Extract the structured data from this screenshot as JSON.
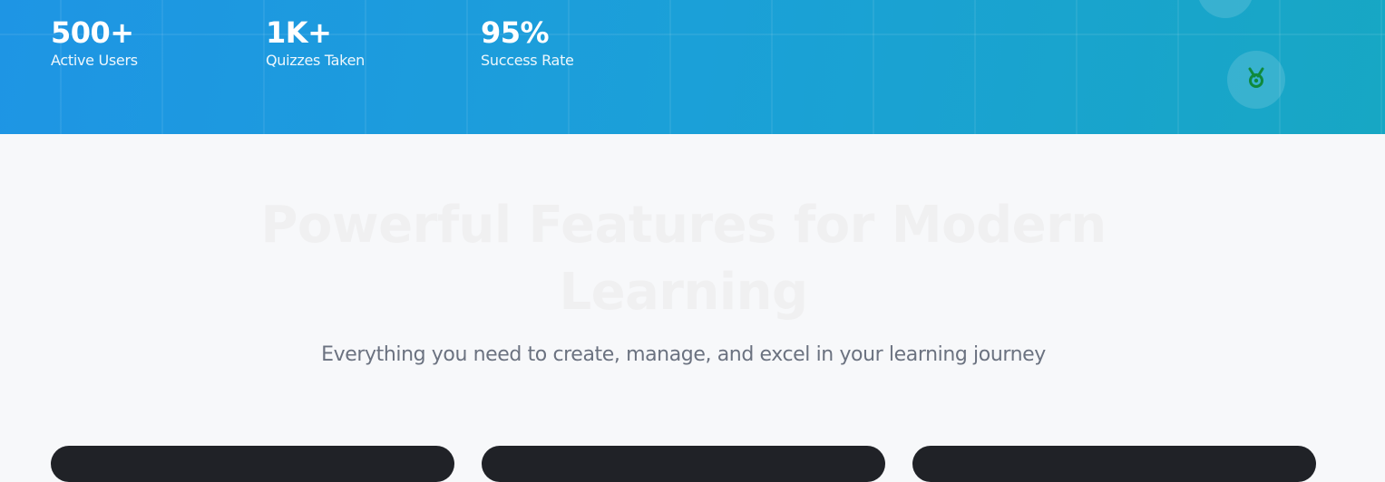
{
  "hero": {
    "stats": [
      {
        "value": "500+",
        "label": "Active Users"
      },
      {
        "value": "1K+",
        "label": "Quizzes Taken"
      },
      {
        "value": "95%",
        "label": "Success Rate"
      }
    ],
    "floating_icons": {
      "medal": "medal-icon",
      "medal_color": "#0f8a3c"
    },
    "gradient_colors": [
      "#1e95e4",
      "#17a7c4"
    ]
  },
  "features": {
    "title": "Powerful Features for Modern Learning",
    "subtitle": "Everything you need to create, manage, and excel in your learning journey",
    "cards_count": 3
  }
}
